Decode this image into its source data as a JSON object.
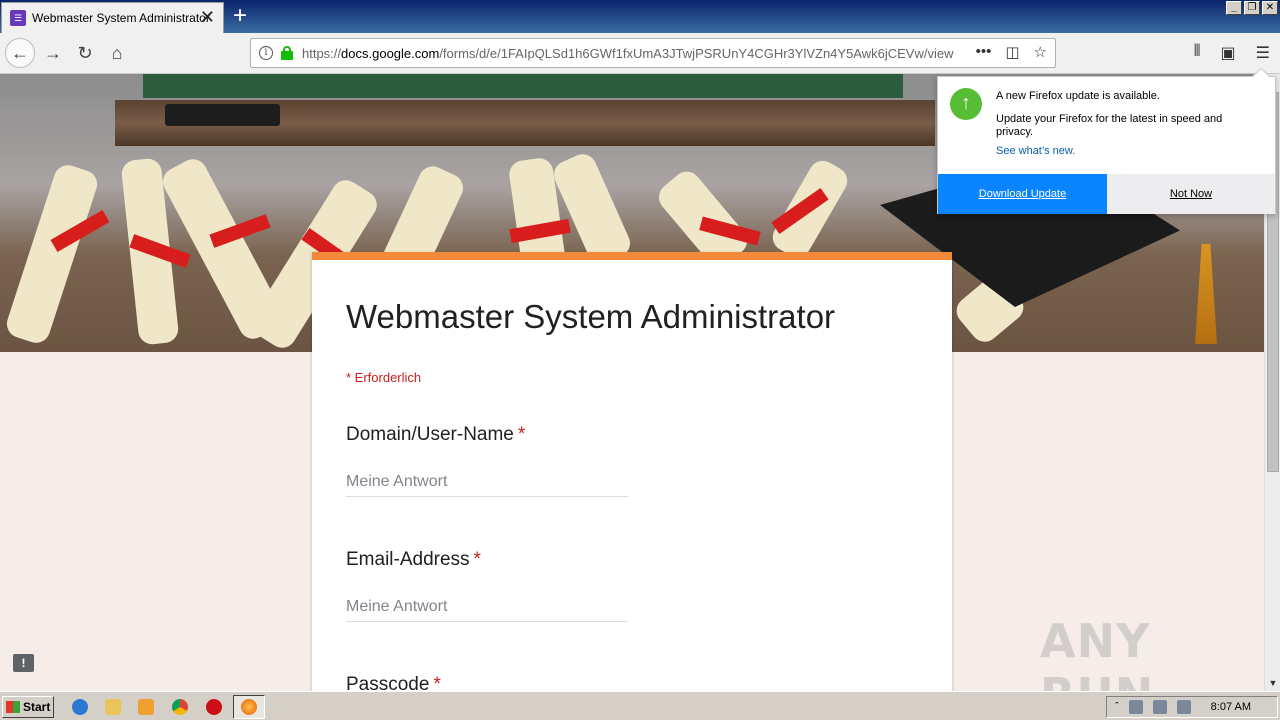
{
  "browser": {
    "tab_title": "Webmaster System Administrator",
    "tab_close": "✕",
    "new_tab": "+",
    "url_host": "docs.google.com",
    "url_prefix": "https://",
    "url_path": "/forms/d/e/1FAIpQLSd1h6GWf1fxUmA3JTwjPSRUnY4CGHr3YlVZn4Y5Awk6jCEVw/view",
    "window_buttons": [
      "_",
      "❐",
      "✕"
    ]
  },
  "form": {
    "title": "Webmaster System Administrator",
    "required_note": "* Erforderlich",
    "questions": [
      {
        "label": "Domain/User-Name",
        "required": "*",
        "placeholder": "Meine Antwort"
      },
      {
        "label": "Email-Address",
        "required": "*",
        "placeholder": "Meine Antwort"
      },
      {
        "label": "Passcode",
        "required": "*"
      }
    ]
  },
  "notification": {
    "headline": "A new Firefox update is available.",
    "body": "Update your Firefox for the latest in speed and privacy.",
    "link": "See what’s new.",
    "primary_button": "Download Update",
    "secondary_button": "Not Now"
  },
  "taskbar": {
    "start_label": "Start",
    "clock": "8:07 AM"
  },
  "watermark": "ANY RUN",
  "colors": {
    "form_accent": "#f38a3a",
    "required": "#c5221f",
    "notif_primary": "#0a84ff",
    "update_icon": "#57bd35"
  }
}
